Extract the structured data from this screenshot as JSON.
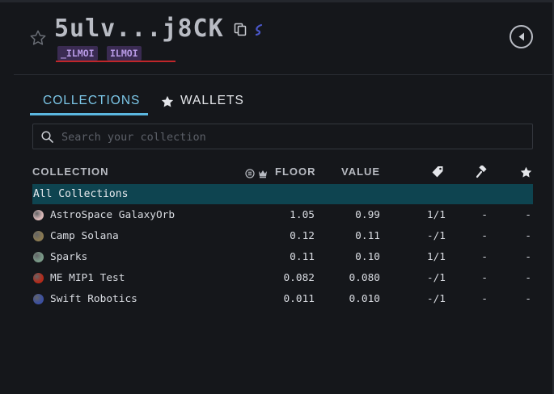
{
  "header": {
    "wallet_address": "5ulv...j8CK",
    "tags": [
      "_ILMOI",
      "ILMOI"
    ],
    "icons": {
      "favorite": "star-outline-icon",
      "copy": "copy-icon",
      "chain": "solana-icon",
      "back": "chevron-left-circle-icon"
    }
  },
  "tabs": [
    {
      "label": "COLLECTIONS",
      "active": true
    },
    {
      "label": "WALLETS",
      "active": false,
      "icon": "star-icon"
    }
  ],
  "search": {
    "placeholder": "Search your collection",
    "value": ""
  },
  "table": {
    "headers": {
      "collection": "COLLECTION",
      "floor": "FLOOR",
      "value": "VALUE",
      "floor_icons": [
        "solana-coin-icon",
        "crown-icon"
      ],
      "listed_icon": "tag-icon",
      "bid_icon": "gavel-icon",
      "fav_icon": "star-icon"
    },
    "all_collections_label": "All Collections",
    "rows": [
      {
        "name": "AstroSpace GalaxyOrb",
        "floor": "1.05",
        "value": "0.99",
        "listed": "1/1",
        "bid": "-",
        "fav": "-",
        "avatar_color": "#d9b8b8"
      },
      {
        "name": "Camp Solana",
        "floor": "0.12",
        "value": "0.11",
        "listed": "-/1",
        "bid": "-",
        "fav": "-",
        "avatar_color": "#8a7a52"
      },
      {
        "name": "Sparks",
        "floor": "0.11",
        "value": "0.10",
        "listed": "1/1",
        "bid": "-",
        "fav": "-",
        "avatar_color": "#7a9a88"
      },
      {
        "name": "ME MIP1 Test",
        "floor": "0.082",
        "value": "0.080",
        "listed": "-/1",
        "bid": "-",
        "fav": "-",
        "avatar_color": "#b32a1a"
      },
      {
        "name": "Swift Robotics",
        "floor": "0.011",
        "value": "0.010",
        "listed": "-/1",
        "bid": "-",
        "fav": "-",
        "avatar_color": "#3b4fa0"
      }
    ]
  },
  "colors": {
    "background": "#15171b",
    "accent": "#5bb7e0",
    "selected_row": "#0e4450",
    "tag_bg": "#3a2b52",
    "tag_text": "#b99be6",
    "underline_red": "#c0262a"
  }
}
